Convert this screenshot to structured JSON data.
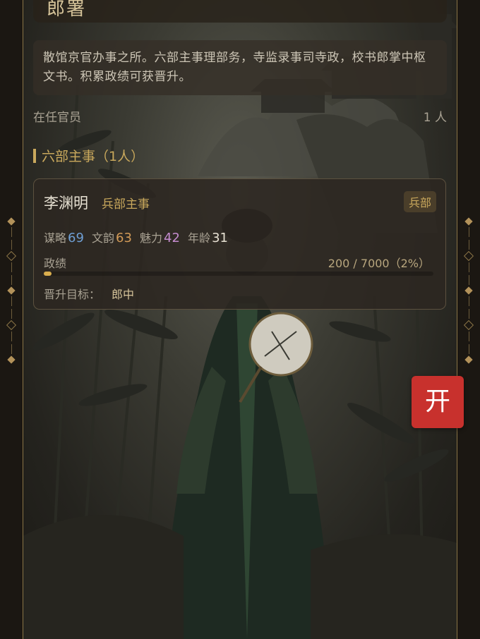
{
  "header": {
    "title": "郎署"
  },
  "description": "散馆京官办事之所。六部主事理部务，寺监录事司寺政，校书郎掌中枢文书。积累政绩可获晋升。",
  "officials": {
    "label": "在任官员",
    "count": "1 人"
  },
  "section": {
    "title": "六部主事（1人）"
  },
  "official_card": {
    "name": "李渊明",
    "office": "兵部主事",
    "department": "兵部",
    "stats": [
      {
        "label": "谋略",
        "value": "69",
        "color": "#6f9fd4"
      },
      {
        "label": "文韵",
        "value": "63",
        "color": "#d29a57"
      },
      {
        "label": "魅力",
        "value": "42",
        "color": "#c58ccf"
      },
      {
        "label": "年龄",
        "value": "31",
        "color": "#e7e1d3"
      }
    ],
    "merit_label": "政绩",
    "merit_value": "200 / 7000（2%）",
    "merit_fraction": 0.02,
    "promotion_label": "晋升目标：",
    "promotion_target": "郎中"
  },
  "floating_button": {
    "label": "开",
    "color": "#c8312d"
  },
  "colors": {
    "accent": "#c9a85c",
    "frame": "#1b1712"
  },
  "icons": [
    "diamond-ornament-icon"
  ]
}
